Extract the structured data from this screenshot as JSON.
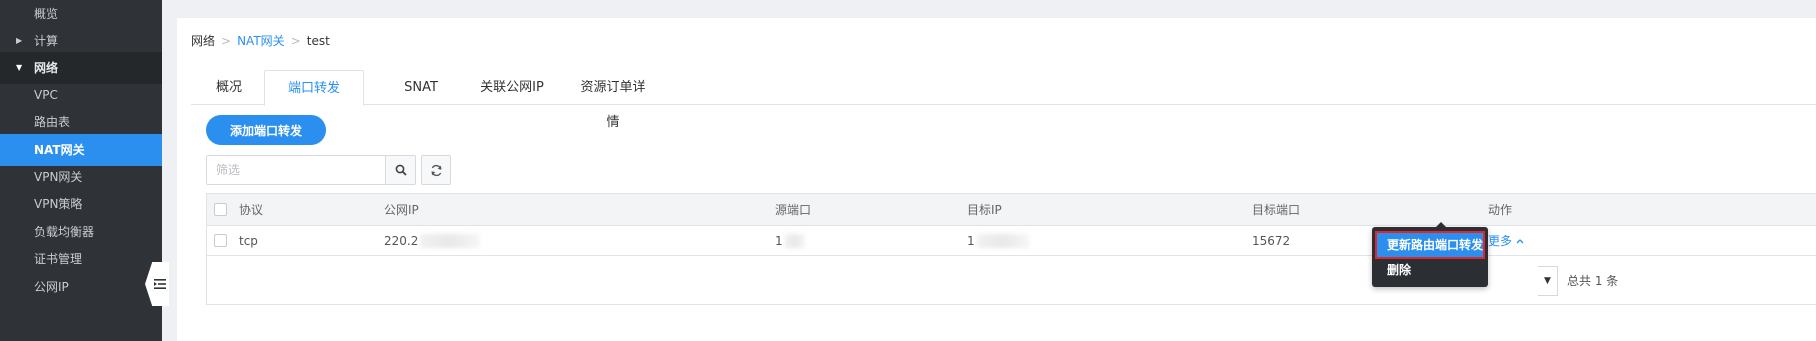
{
  "sidebar": {
    "items": [
      {
        "label": "概览"
      },
      {
        "label": "计算"
      },
      {
        "label": "网络"
      },
      {
        "label": "VPC"
      },
      {
        "label": "路由表"
      },
      {
        "label": "NAT网关"
      },
      {
        "label": "VPN网关"
      },
      {
        "label": "VPN策略"
      },
      {
        "label": "负载均衡器"
      },
      {
        "label": "证书管理"
      },
      {
        "label": "公网IP"
      }
    ]
  },
  "breadcrumb": {
    "root": "网络",
    "parent": "NAT网关",
    "current": "test",
    "separator": ">"
  },
  "tabs": [
    {
      "label": "概况"
    },
    {
      "label": "端口转发"
    },
    {
      "label": "SNAT"
    },
    {
      "label": "关联公网IP"
    },
    {
      "label": "资源订单详情"
    }
  ],
  "toolbar": {
    "add_label": "添加端口转发",
    "filter_placeholder": "筛选"
  },
  "table": {
    "headers": {
      "protocol": "协议",
      "public_ip": "公网IP",
      "source_port": "源端口",
      "target_ip": "目标IP",
      "target_port": "目标端口",
      "action": "动作"
    },
    "rows": [
      {
        "protocol": "tcp",
        "public_ip": "220.2",
        "source_port": "1",
        "target_ip": "1",
        "target_port": "15672",
        "action": "更多"
      }
    ]
  },
  "pagination": {
    "total": "总共 1 条"
  },
  "dropdown": {
    "update_label": "更新路由端口转发",
    "delete_label": "删除"
  },
  "colors": {
    "accent": "#2b8ff0",
    "sidebar_bg": "#2f3236",
    "highlight_border": "#e0262b"
  }
}
